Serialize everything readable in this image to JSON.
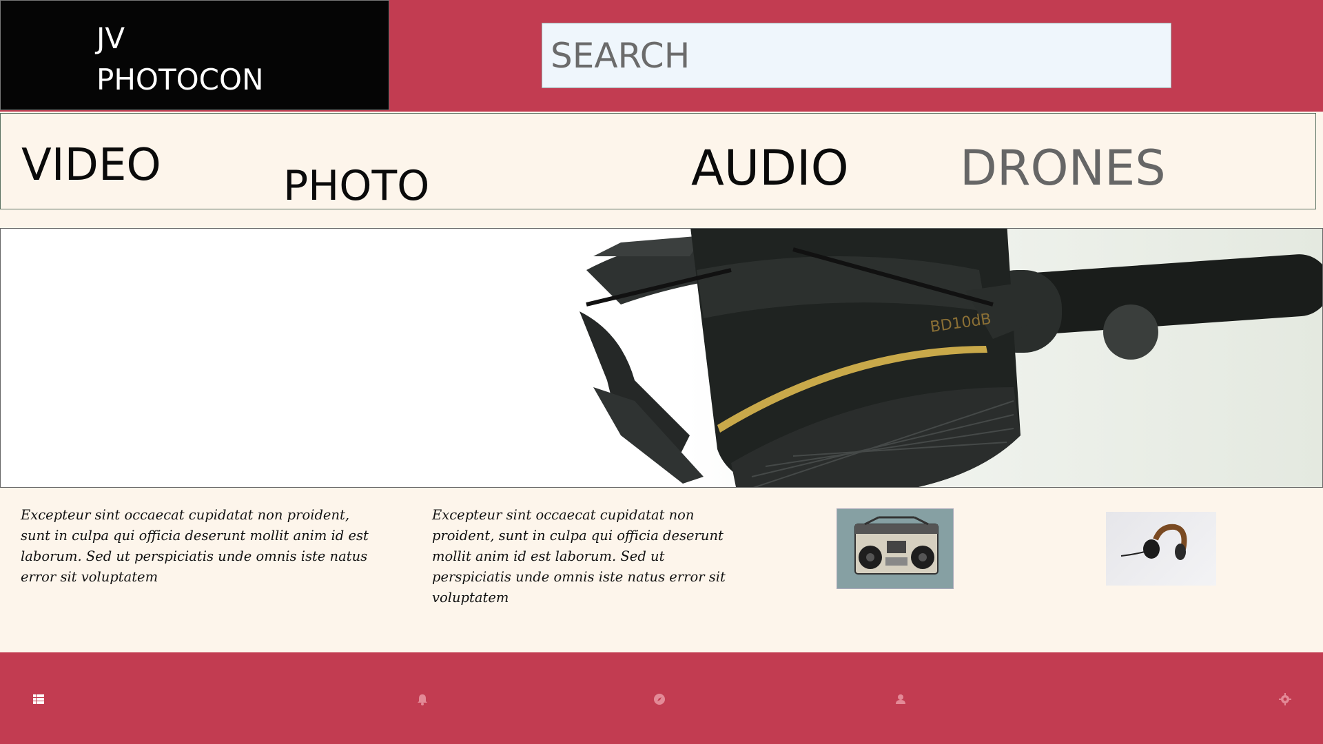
{
  "brand": {
    "line1": "JV",
    "line2": "PHOTOCON"
  },
  "search": {
    "placeholder": "SEARCH",
    "value": ""
  },
  "nav": {
    "items": [
      {
        "label": "VIDEO"
      },
      {
        "label": "PHOTO"
      },
      {
        "label": "AUDIO"
      },
      {
        "label": "DRONES"
      }
    ]
  },
  "content": {
    "paragraphs": [
      "Excepteur sint occaecat cupidatat non proident, sunt in culpa qui officia deserunt mollit anim id est laborum. Sed ut perspiciatis unde omnis iste natus error sit voluptatem",
      "Excepteur sint occaecat cupidatat non proident, sunt in culpa qui officia deserunt mollit anim id est laborum. Sed ut perspiciatis unde omnis iste natus error sit voluptatem"
    ]
  },
  "footer": {
    "icons": [
      "menu-list-icon",
      "bell-icon",
      "compass-icon",
      "user-icon",
      "gear-icon"
    ]
  },
  "colors": {
    "accent": "#c23c51",
    "background": "#fdf5eb",
    "brand_bg": "#050505",
    "search_bg": "#eff6fc"
  }
}
